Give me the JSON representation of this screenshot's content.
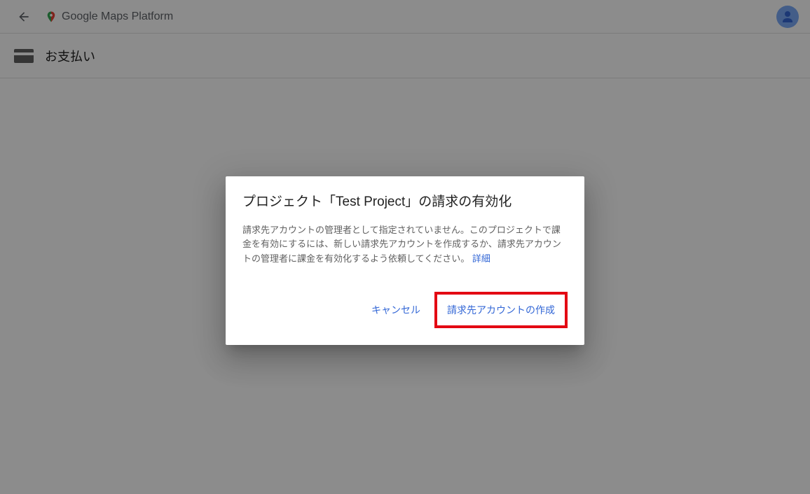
{
  "header": {
    "product_name": "Google Maps Platform"
  },
  "subheader": {
    "page_title": "お支払い"
  },
  "dialog": {
    "title": "プロジェクト「Test Project」の請求の有効化",
    "body_text": "請求先アカウントの管理者として指定されていません。このプロジェクトで課金を有効にするには、新しい請求先アカウントを作成するか、請求先アカウントの管理者に課金を有効化するよう依頼してください。 ",
    "detail_link": "詳細",
    "cancel_label": "キャンセル",
    "create_label": "請求先アカウントの作成"
  }
}
